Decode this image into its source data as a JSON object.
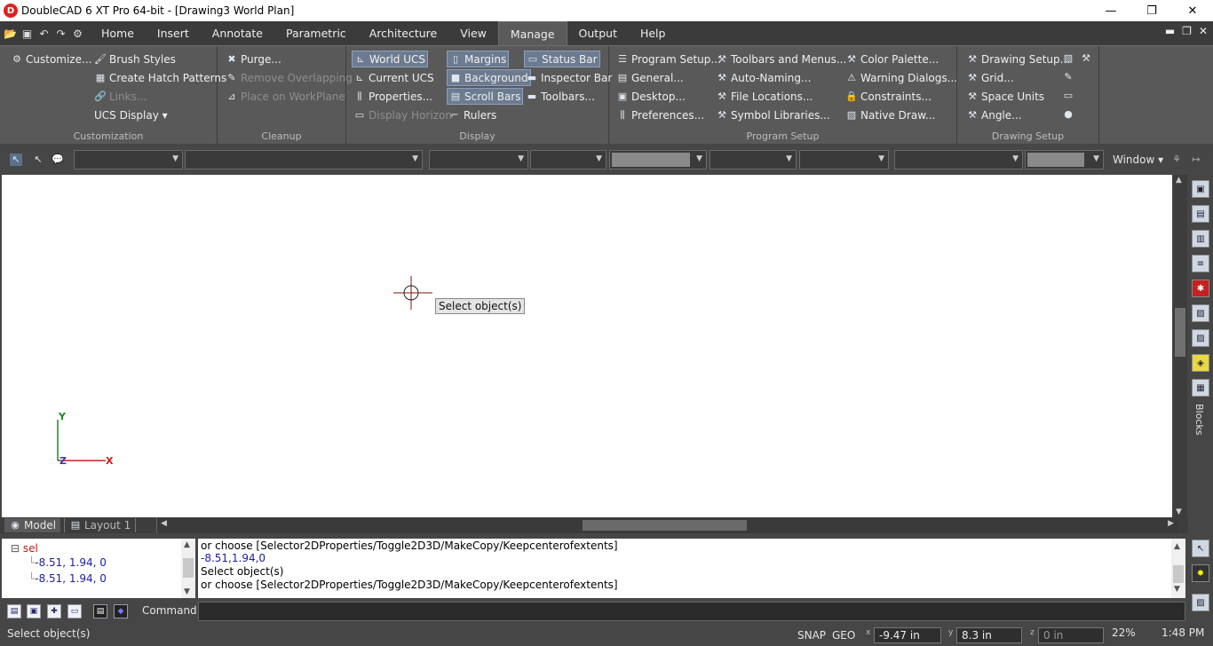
{
  "window": {
    "title": "DoubleCAD 6 XT Pro 64-bit - [Drawing3 World Plan]",
    "logo_letter": "D",
    "minimize": "—",
    "maximize": "❐",
    "close": "✕"
  },
  "menu": {
    "tabs": [
      "Home",
      "Insert",
      "Annotate",
      "Parametric",
      "Architecture",
      "View",
      "Manage",
      "Output",
      "Help"
    ],
    "active": "Manage"
  },
  "ribbon": {
    "customization": {
      "label": "Customization",
      "customize": "Customize...",
      "brush_styles": "Brush Styles",
      "create_hatch": "Create Hatch Patterns",
      "links": "Links...",
      "ucs_display": "UCS Display ▾"
    },
    "cleanup": {
      "label": "Cleanup",
      "purge": "Purge...",
      "remove_overlapping": "Remove Overlapping",
      "place_on_workplane": "Place on WorkPlane"
    },
    "display": {
      "label": "Display",
      "world_ucs": "World UCS",
      "current_ucs": "Current UCS",
      "properties": "Properties...",
      "display_horizon": "Display Horizon",
      "margins": "Margins",
      "background": "Background",
      "scroll_bars": "Scroll Bars",
      "rulers": "Rulers",
      "status_bar": "Status Bar",
      "inspector_bar": "Inspector Bar",
      "toolbars": "Toolbars..."
    },
    "program_setup": {
      "label": "Program Setup",
      "program_setup": "Program Setup...",
      "general": "General...",
      "desktop": "Desktop...",
      "preferences": "Preferences...",
      "toolbars_menus": "Toolbars and Menus...",
      "auto_naming": "Auto-Naming...",
      "file_locations": "File Locations...",
      "symbol_libraries": "Symbol Libraries...",
      "color_palette": "Color Palette...",
      "warning_dialogs": "Warning Dialogs...",
      "constraints": "Constraints...",
      "native_draw": "Native Draw..."
    },
    "drawing_setup": {
      "label": "Drawing Setup",
      "drawing_setup": "Drawing Setup...",
      "grid": "Grid...",
      "space_units": "Space Units",
      "angle": "Angle..."
    }
  },
  "toolbar": {
    "window_label": "Window ▾"
  },
  "canvas": {
    "tooltip": "Select object(s)",
    "axis_y": "Y",
    "axis_x": "X",
    "axis_z": "Z"
  },
  "sheets": {
    "model": "Model",
    "layout1": "Layout 1"
  },
  "history": {
    "root": "sel",
    "items": [
      "-8.51, 1.94, 0",
      "-8.51, 1.94, 0"
    ]
  },
  "command_log": [
    "or choose [Selector2DProperties/Toggle2D3D/MakeCopy/Keepcenterofextents]",
    "-8.51,1.94,0",
    "Select object(s)",
    "or choose [Selector2DProperties/Toggle2D3D/MakeCopy/Keepcenterofextents]"
  ],
  "command": {
    "label": "Command:"
  },
  "right_panel": {
    "blocks_label": "Blocks"
  },
  "status": {
    "prompt": "Select object(s)",
    "snap": "SNAP",
    "geo": "GEO",
    "x_label": "x",
    "y_label": "y",
    "z_label": "z",
    "x": "-9.47 in",
    "y": "8.3 in",
    "z": "0 in",
    "zoom": "22%",
    "time": "1:48 PM"
  },
  "colors": {
    "accent": "#6c7b90",
    "axis_x": "#c8201e",
    "axis_y": "#1b8a1b",
    "axis_z": "#2a3fae",
    "history_text": "#1e1e9e"
  }
}
